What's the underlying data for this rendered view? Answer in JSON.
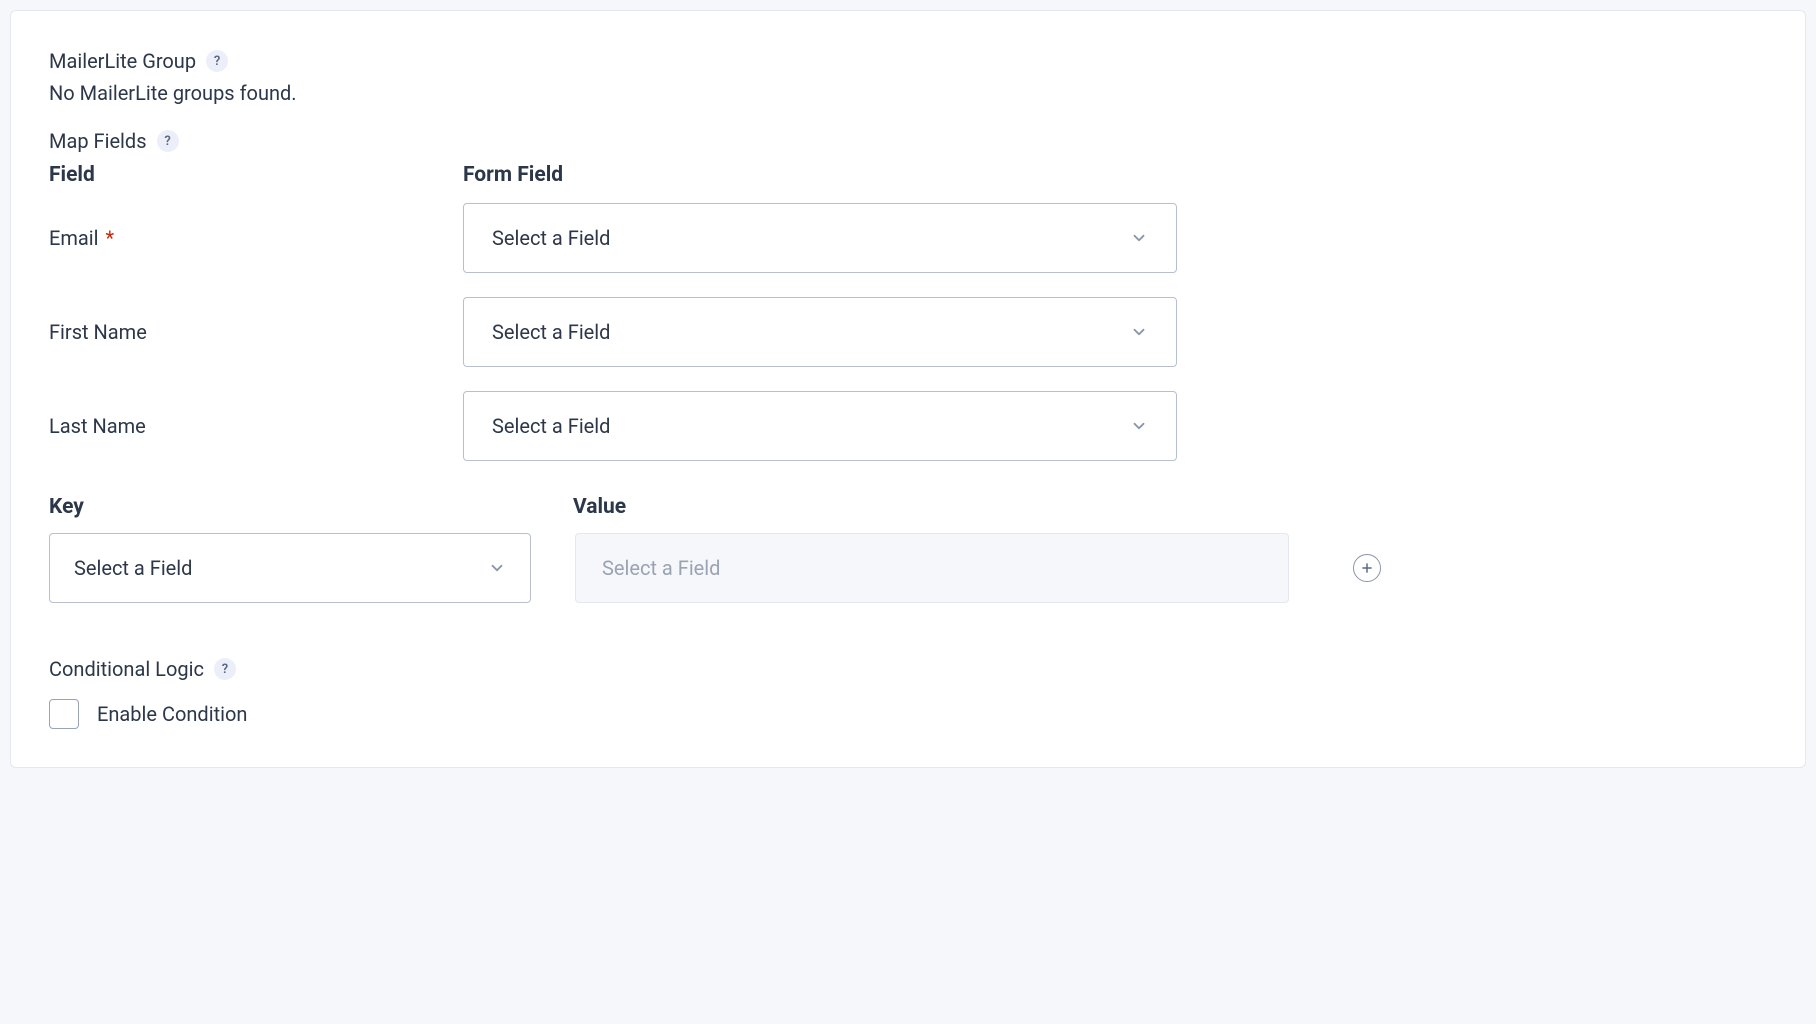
{
  "mailerlite_group": {
    "label": "MailerLite Group",
    "empty_message": "No MailerLite groups found."
  },
  "map_fields": {
    "label": "Map Fields",
    "headers": {
      "field": "Field",
      "form_field": "Form Field"
    },
    "rows": [
      {
        "label": "Email",
        "required": true,
        "selected": "Select a Field"
      },
      {
        "label": "First Name",
        "required": false,
        "selected": "Select a Field"
      },
      {
        "label": "Last Name",
        "required": false,
        "selected": "Select a Field"
      }
    ]
  },
  "custom_fields": {
    "headers": {
      "key": "Key",
      "value": "Value"
    },
    "key_selected": "Select a Field",
    "value_placeholder": "Select a Field"
  },
  "conditional_logic": {
    "label": "Conditional Logic",
    "checkbox_label": "Enable Condition"
  },
  "help_icon_text": "?",
  "required_marker": "*"
}
